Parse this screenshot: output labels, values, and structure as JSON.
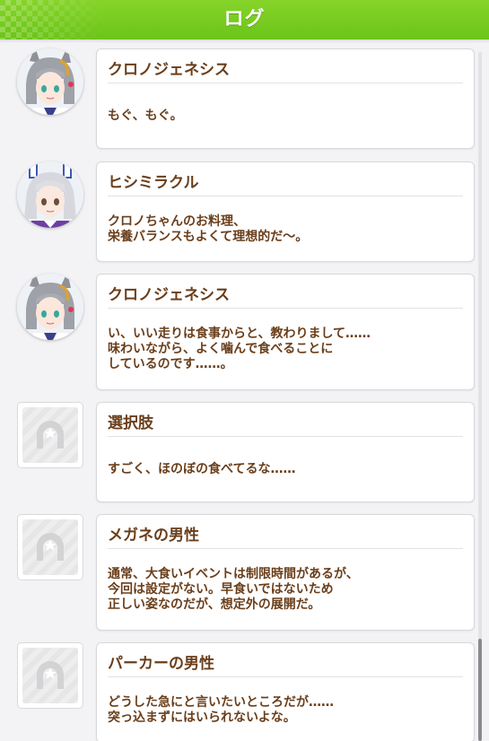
{
  "header": {
    "title": "ログ",
    "accent_color": "#77cc1e"
  },
  "log": {
    "entries": [
      {
        "speaker": "クロノジェネシス",
        "message": "もぐ、もぐ。",
        "avatar_icon": "character-portrait-gray-hair-icon"
      },
      {
        "speaker": "ヒシミラクル",
        "message": "クロノちゃんのお料理、\n栄養バランスもよくて理想的だ～。",
        "avatar_icon": "character-portrait-silver-hair-icon"
      },
      {
        "speaker": "クロノジェネシス",
        "message": "い、いい走りは食事からと、教わりまして……\n味わいながら、よく噛んで食べることに\nしているのです……。",
        "avatar_icon": "character-portrait-gray-hair-icon"
      },
      {
        "speaker": "選択肢",
        "message": "すごく、ほのぼの食べてるな……",
        "avatar_icon": "horseshoe-placeholder-icon"
      },
      {
        "speaker": "メガネの男性",
        "message": "通常、大食いイベントは制限時間があるが、\n今回は設定がない。早食いではないため\n正しい姿なのだが、想定外の展開だ。",
        "avatar_icon": "horseshoe-placeholder-icon"
      },
      {
        "speaker": "パーカーの男性",
        "message": "どうした急にと言いたいところだが……\n突っ込まずにはいられないよな。",
        "avatar_icon": "horseshoe-placeholder-icon"
      }
    ]
  },
  "colors": {
    "text_brown": "#6a3e1a",
    "bubble_border": "#d8d8dc"
  }
}
